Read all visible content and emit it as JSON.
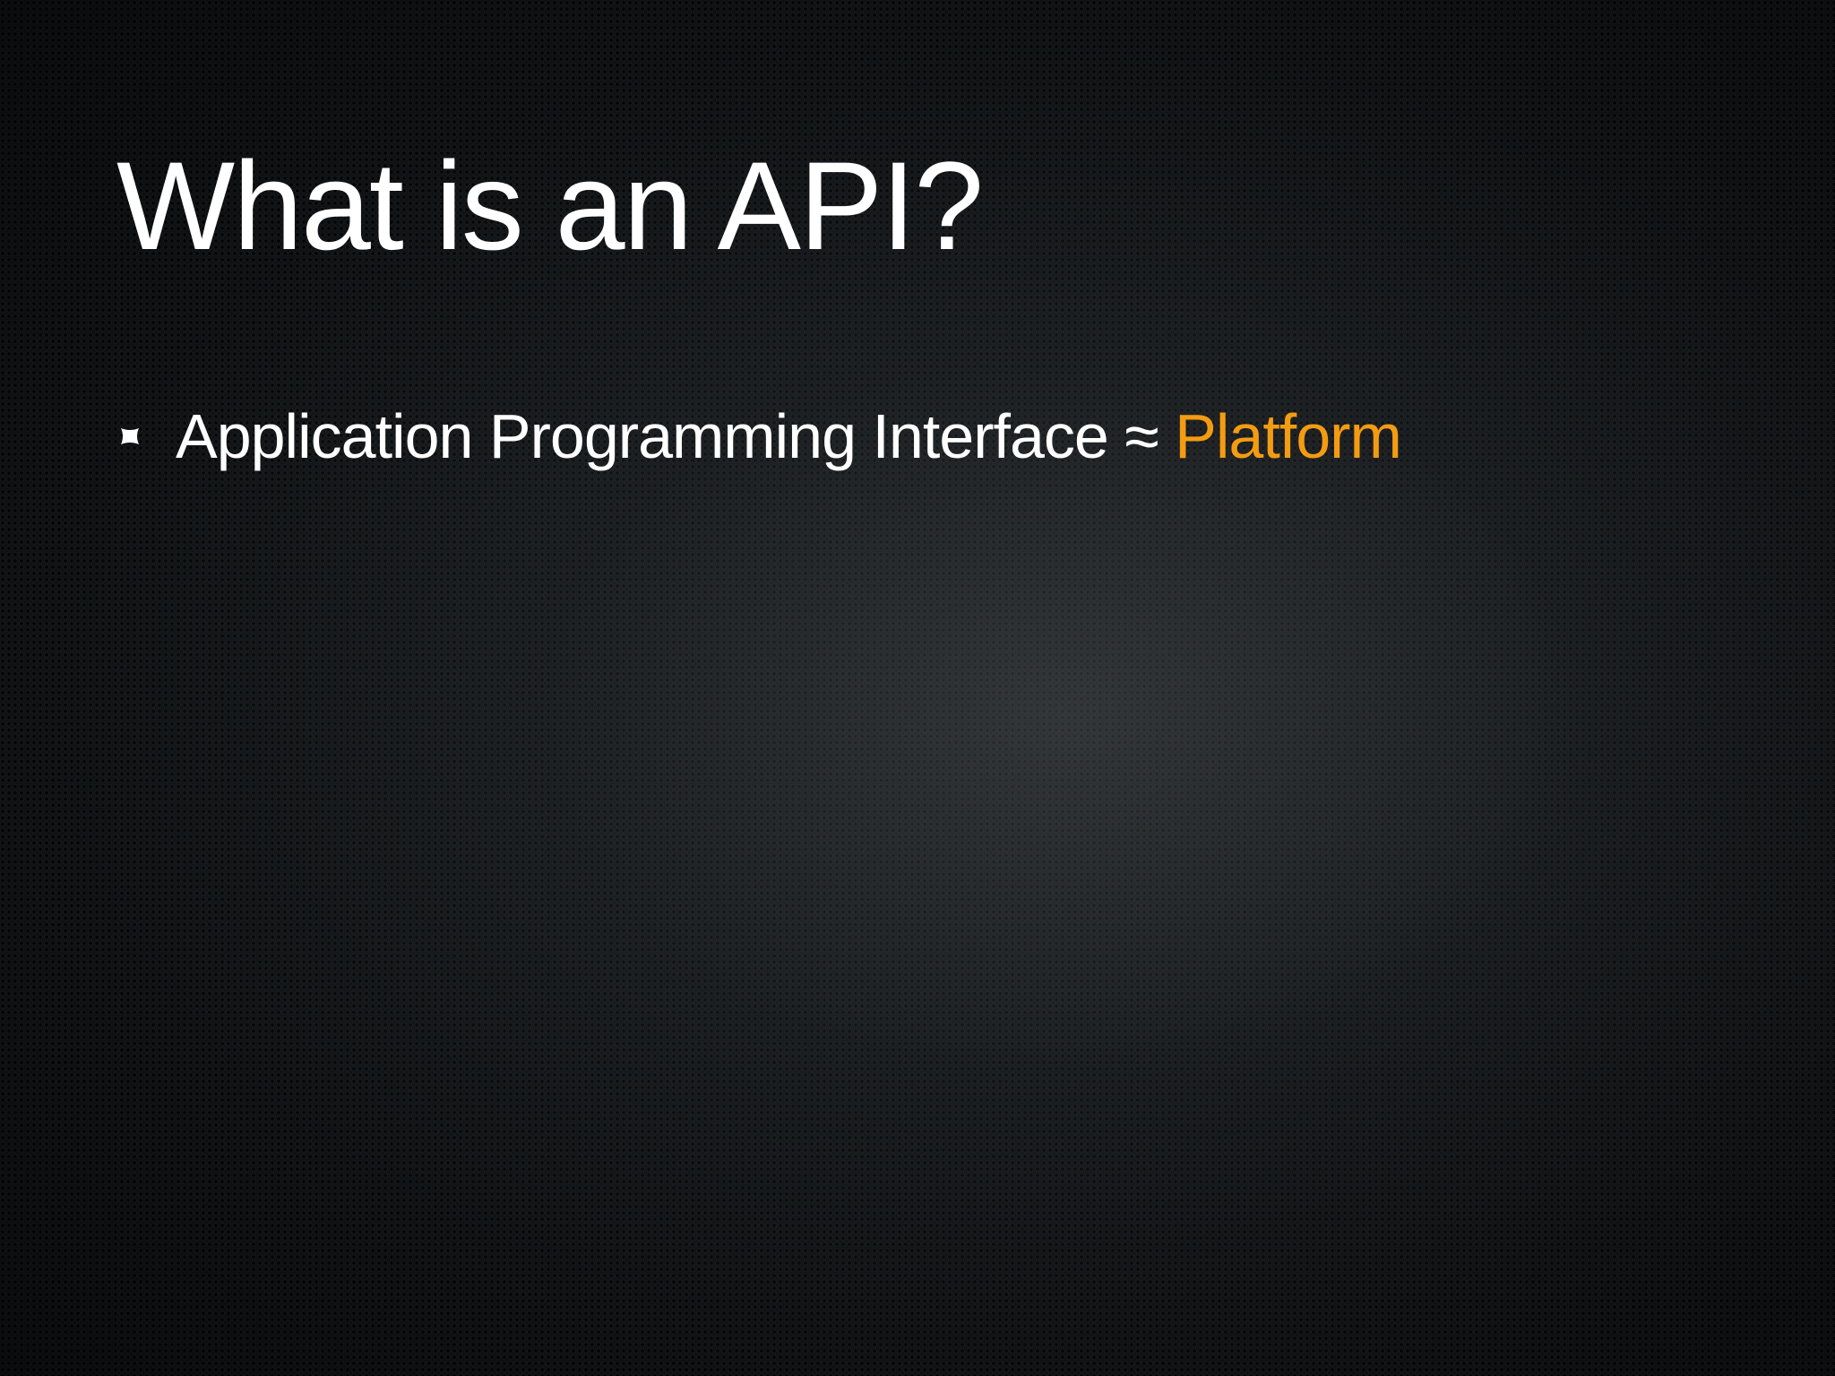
{
  "slide": {
    "title": "What is an API?",
    "bullets": [
      {
        "text": "Application Programming Interface ≈ ",
        "highlight": "Platform",
        "highlight_color": "#f39c12"
      }
    ],
    "bullet_icon": "bullet-square-icon"
  }
}
